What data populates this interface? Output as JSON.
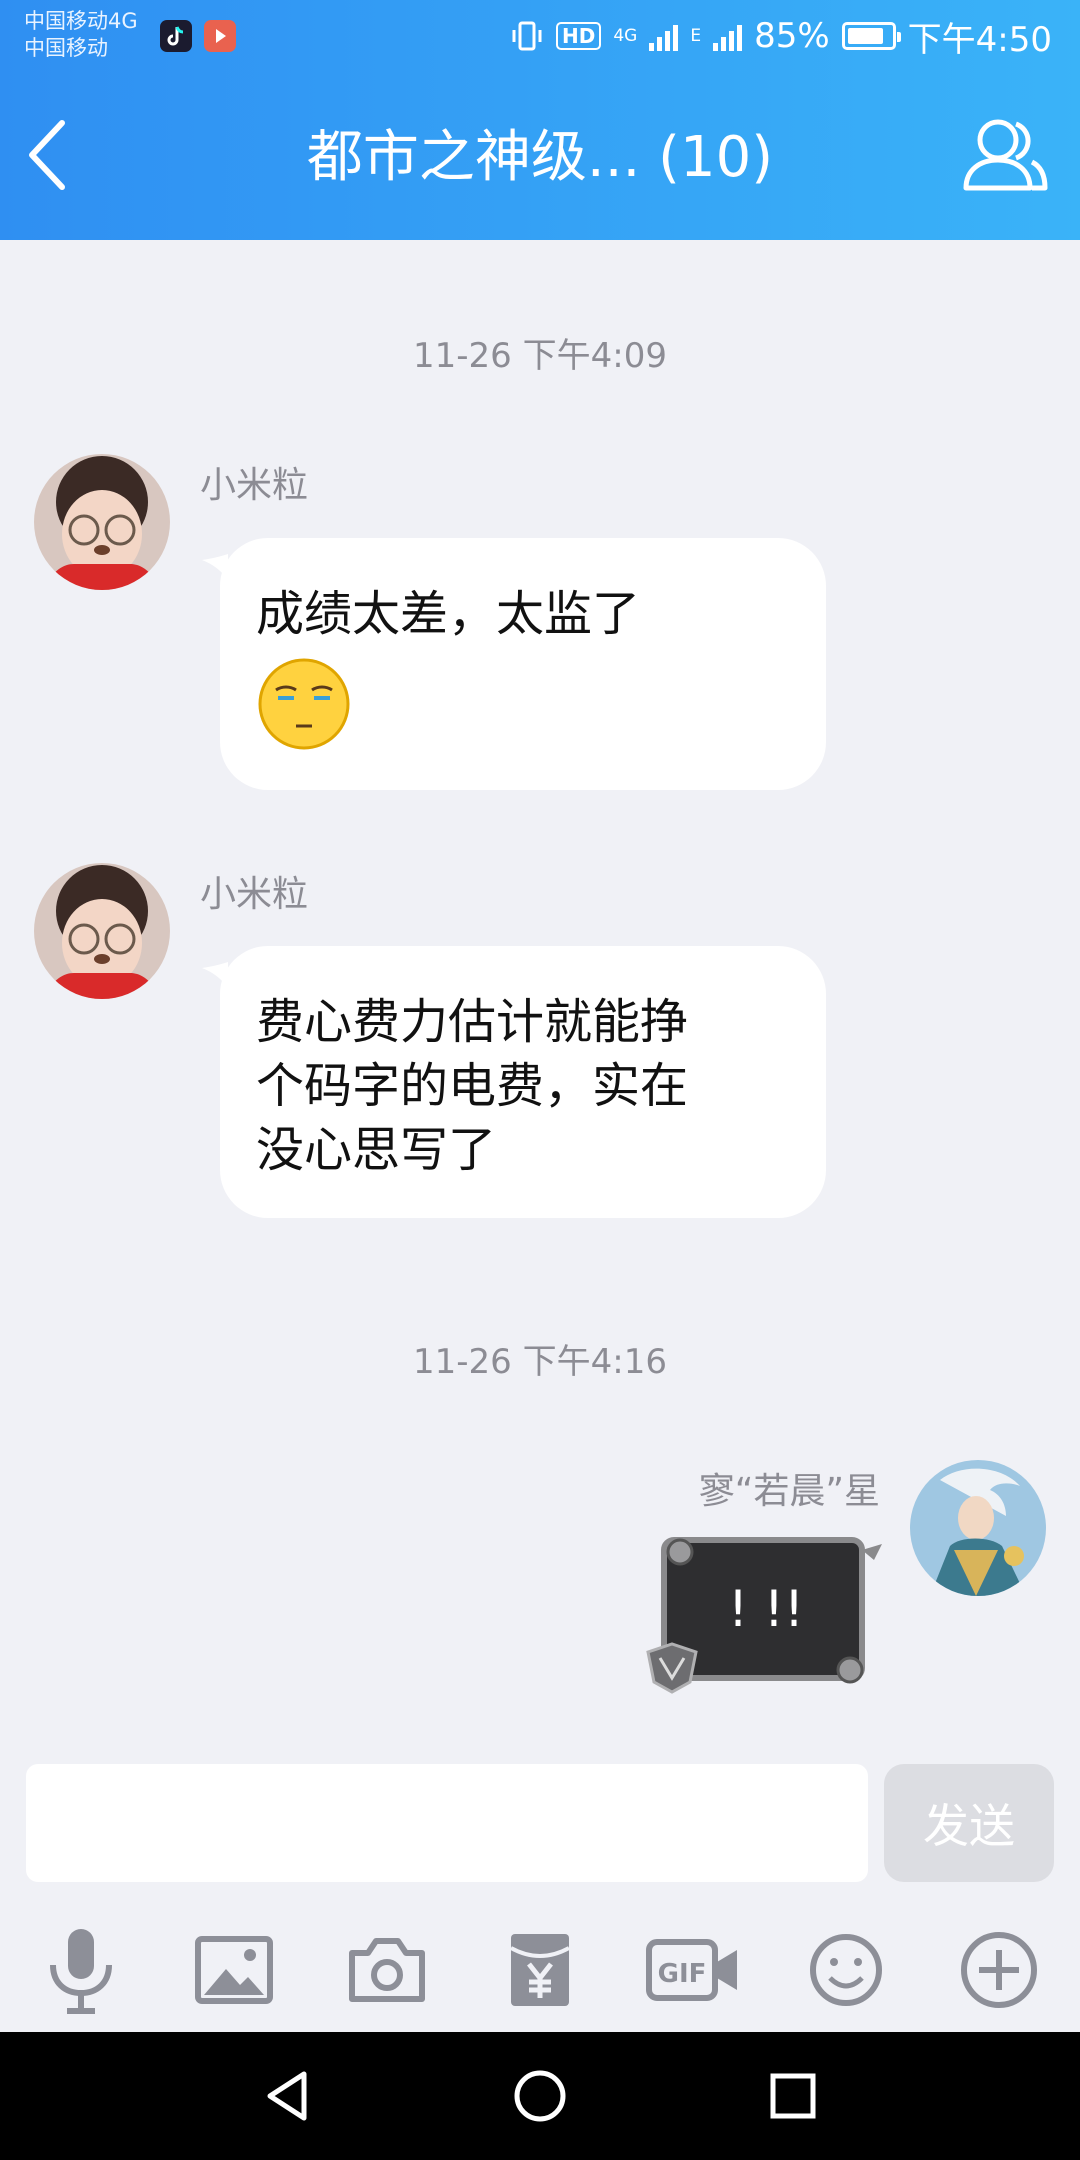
{
  "status_bar": {
    "carrier_1": "中国移动4G",
    "carrier_2": "中国移动",
    "hd": "HD",
    "network_tag": "4G",
    "signal_tag": "E",
    "battery": "85%",
    "battery_level": 0.85,
    "time": "下午4:50"
  },
  "header": {
    "title": "都市之神级... (10)",
    "back_icon": "chevron-left-icon",
    "group_icon": "group-members-icon"
  },
  "messages": [
    {
      "timestamp": "11-26 下午4:09"
    },
    {
      "sender": "小米粒",
      "text": "成绩太差，太监了",
      "emoji": "speechless-face-emoji"
    },
    {
      "sender": "小米粒",
      "text_lines": [
        "费心费力估计就能挣",
        "个码字的电费，实在",
        "没心思写了"
      ]
    },
    {
      "timestamp": "11-26 下午4:16"
    },
    {
      "sender": "寥“若晨”星",
      "sticker_text": "! !!"
    }
  ],
  "input": {
    "placeholder": "",
    "send_label": "发送"
  },
  "toolbar": [
    "microphone-icon",
    "image-icon",
    "camera-icon",
    "red-packet-icon",
    "gif-icon",
    "emoji-icon",
    "plus-icon"
  ],
  "nav": [
    "back-triangle-icon",
    "home-circle-icon",
    "recents-square-icon"
  ],
  "colors": {
    "header_start": "#2f8ff2",
    "header_end": "#3ab3f8",
    "background": "#f0f1f6",
    "bubble": "#ffffff",
    "send_disabled": "#dcdde2"
  }
}
